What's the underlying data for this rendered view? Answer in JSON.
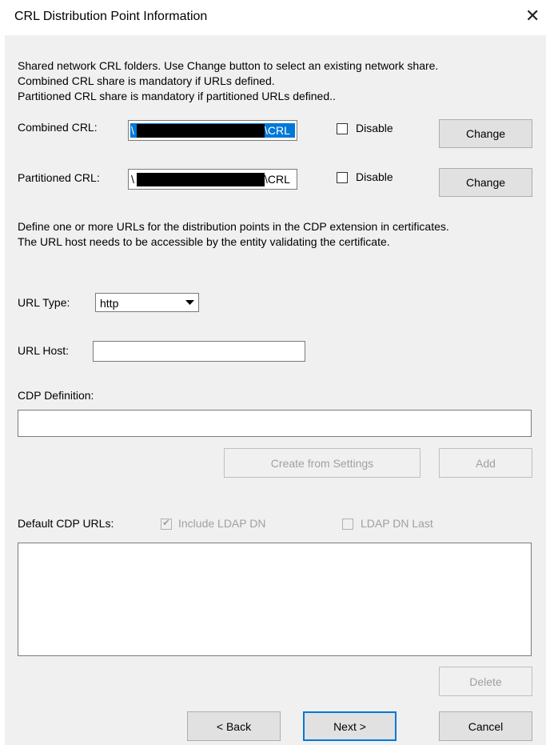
{
  "window": {
    "title": "CRL Distribution Point Information"
  },
  "intro": {
    "line1": "Shared network CRL folders. Use Change button to select an existing network share.",
    "line2": "Combined CRL share is mandatory if URLs defined.",
    "line3": "Partitioned CRL share is mandatory if partitioned URLs defined.."
  },
  "combined": {
    "label": "Combined CRL:",
    "prefix": "\\",
    "suffix": "\\CRL",
    "disable_label": "Disable",
    "change_label": "Change"
  },
  "partitioned": {
    "label": "Partitioned CRL:",
    "prefix": "\\",
    "suffix": "\\CRL",
    "disable_label": "Disable",
    "change_label": "Change"
  },
  "urls_desc": {
    "line1": "Define one or more URLs for the distribution points in the CDP extension in certificates.",
    "line2": "The URL host needs to be accessible by the entity validating the certificate."
  },
  "url_type": {
    "label": "URL Type:",
    "value": "http"
  },
  "url_host": {
    "label": "URL Host:",
    "value": ""
  },
  "cdp": {
    "label": "CDP Definition:",
    "value": "",
    "create_label": "Create from Settings",
    "add_label": "Add"
  },
  "defaults": {
    "label": "Default CDP URLs:",
    "include_ldap_label": "Include LDAP DN",
    "include_ldap_checked": true,
    "ldap_last_label": "LDAP DN Last",
    "ldap_last_checked": false,
    "delete_label": "Delete"
  },
  "nav": {
    "back_label": "< Back",
    "next_label": "Next >",
    "cancel_label": "Cancel"
  }
}
